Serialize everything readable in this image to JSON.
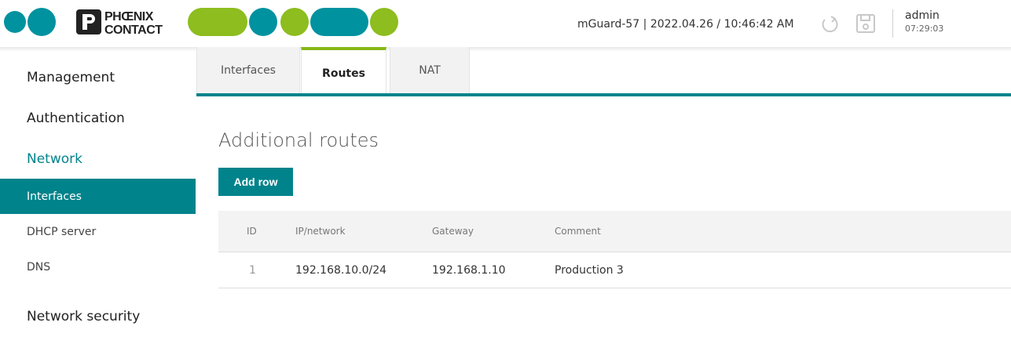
{
  "header": {
    "logo_text": "PHOENIX CONTACT",
    "device_info": "mGuard-57 | 2022.04.26 / 10:46:42 AM",
    "reload_icon": "reload-icon",
    "save_icon": "save-icon",
    "user_name": "admin",
    "session_time": "07:29:03"
  },
  "colors": {
    "teal": "#00838b",
    "green": "#86b817",
    "logo_teal": "#00929f",
    "logo_green": "#8dbd1e"
  },
  "sidebar": {
    "sections": [
      {
        "label": "Management"
      },
      {
        "label": "Authentication"
      },
      {
        "label": "Network"
      },
      {
        "label": "Network security"
      }
    ],
    "items": [
      {
        "label": "Interfaces"
      },
      {
        "label": "DHCP server"
      },
      {
        "label": "DNS"
      }
    ]
  },
  "tabs": [
    {
      "label": "Interfaces"
    },
    {
      "label": "Routes"
    },
    {
      "label": "NAT"
    }
  ],
  "main": {
    "title": "Additional routes",
    "add_row_label": "Add row",
    "table": {
      "headers": [
        "ID",
        "IP/network",
        "Gateway",
        "Comment"
      ],
      "rows": [
        [
          "1",
          "192.168.10.0/24",
          "192.168.1.10",
          "Production 3"
        ]
      ]
    }
  }
}
